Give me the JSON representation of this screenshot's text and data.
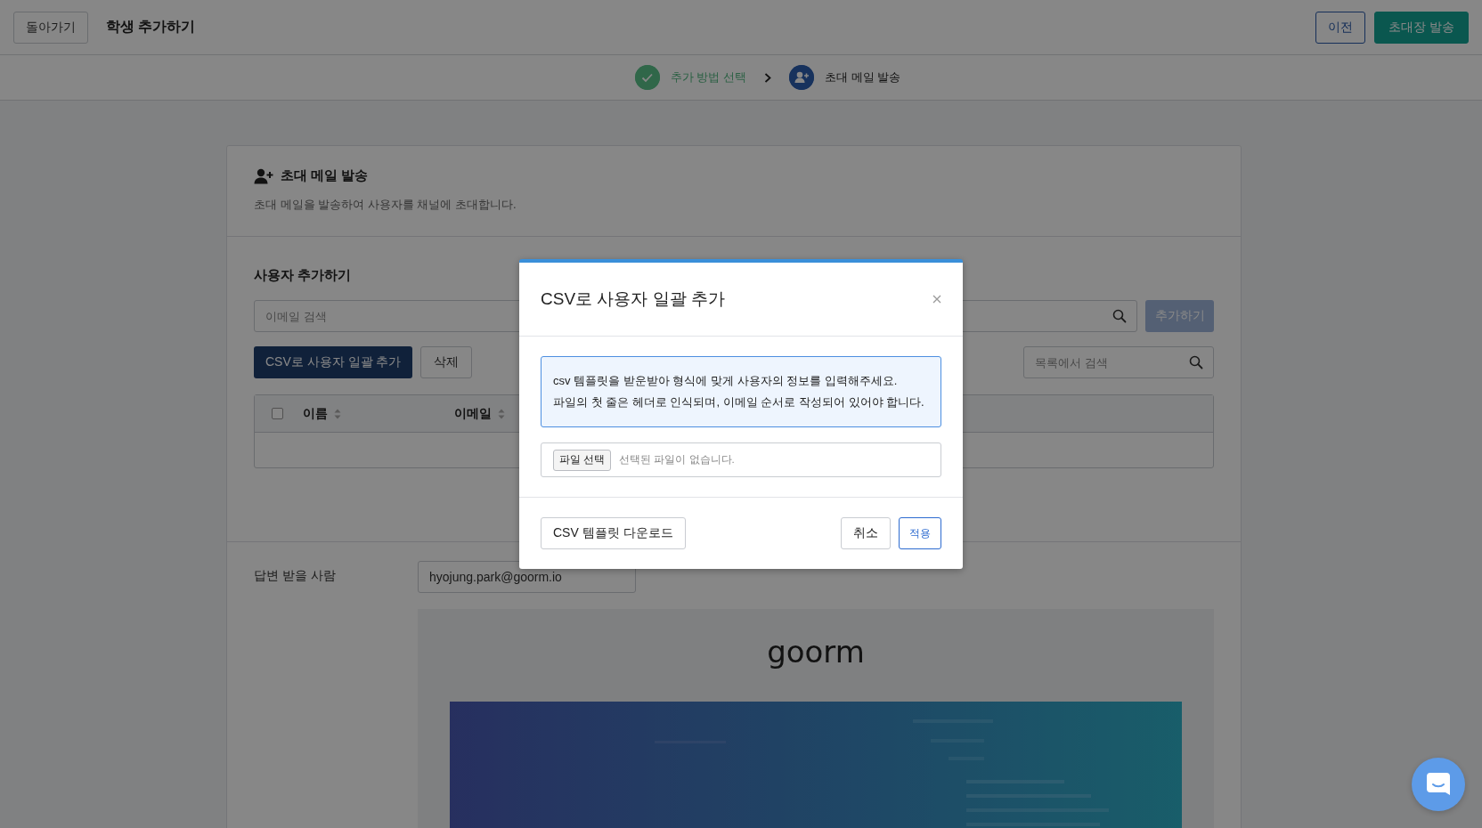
{
  "header": {
    "back_button": "돌아가기",
    "title": "학생 추가하기",
    "prev_button": "이전",
    "send_button": "초대장 발송"
  },
  "stepper": {
    "steps": [
      {
        "label": "추가 방법 선택",
        "completed": true
      },
      {
        "label": "초대 메일 발송",
        "completed": false
      }
    ]
  },
  "card": {
    "title": "초대 메일 발송",
    "subtitle": "초대 메일을 발송하여 사용자를 채널에 초대합니다.",
    "add_section": {
      "title": "사용자 추가하기",
      "email_search": {
        "placeholder": "이메일 검색"
      },
      "add_button": {
        "label": "추가하기",
        "disabled": true
      },
      "csv_button": "CSV로 사용자 일괄 추가",
      "delete_button": "삭제",
      "list_search": {
        "placeholder": "목록에서 검색"
      },
      "table": {
        "select_all": {
          "checked": false
        },
        "columns": [
          {
            "label": "이름",
            "sortable": true
          },
          {
            "label": "이메일",
            "sortable": true
          }
        ]
      }
    },
    "reply_to": {
      "label": "답변 받을 사람",
      "value": "hyojung.park@goorm.io"
    },
    "preview": {
      "logo": "goorm"
    }
  },
  "modal": {
    "title": "CSV로 사용자 일괄 추가",
    "info_lines": [
      "csv 템플릿을 받운받아 형식에 맞게 사용자의 정보를 입력해주세요.",
      "파일의 첫 줄은 헤더로 인식되며, 이메일 순서로 작성되어 있어야 합니다."
    ],
    "file_button": "파일 선택",
    "file_status": "선택된 파일이 없습니다.",
    "template_button": "CSV 템플릿 다운로드",
    "cancel_button": "취소",
    "apply_button": "적용"
  }
}
